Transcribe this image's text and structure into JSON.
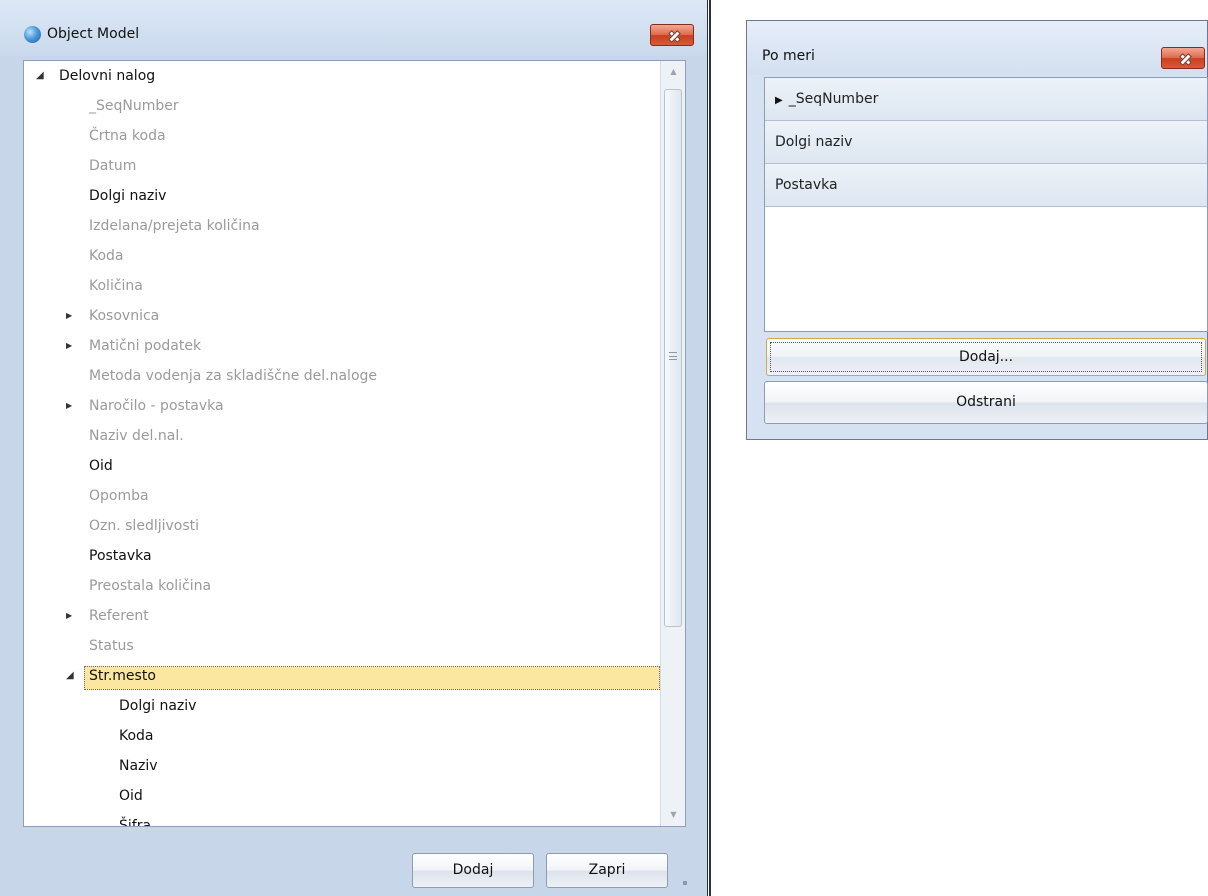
{
  "object_model_window": {
    "title": "Object Model",
    "close_icon": "close-x-icon",
    "tree": [
      {
        "label": "Delovni nalog",
        "level": 0,
        "expander": "expanded",
        "style": "dark"
      },
      {
        "label": "_SeqNumber",
        "level": 1,
        "expander": "none",
        "style": "gray"
      },
      {
        "label": "Črtna koda",
        "level": 1,
        "expander": "none",
        "style": "gray"
      },
      {
        "label": "Datum",
        "level": 1,
        "expander": "none",
        "style": "gray"
      },
      {
        "label": "Dolgi naziv",
        "level": 1,
        "expander": "none",
        "style": "dark"
      },
      {
        "label": "Izdelana/prejeta količina",
        "level": 1,
        "expander": "none",
        "style": "gray"
      },
      {
        "label": "Koda",
        "level": 1,
        "expander": "none",
        "style": "gray"
      },
      {
        "label": "Količina",
        "level": 1,
        "expander": "none",
        "style": "gray"
      },
      {
        "label": "Kosovnica",
        "level": 1,
        "expander": "collapsed",
        "style": "gray"
      },
      {
        "label": "Matični podatek",
        "level": 1,
        "expander": "collapsed",
        "style": "gray"
      },
      {
        "label": "Metoda vodenja za skladiščne del.naloge",
        "level": 1,
        "expander": "none",
        "style": "gray"
      },
      {
        "label": "Naročilo - postavka",
        "level": 1,
        "expander": "collapsed",
        "style": "gray"
      },
      {
        "label": "Naziv del.nal.",
        "level": 1,
        "expander": "none",
        "style": "gray"
      },
      {
        "label": "Oid",
        "level": 1,
        "expander": "none",
        "style": "dark"
      },
      {
        "label": "Opomba",
        "level": 1,
        "expander": "none",
        "style": "gray"
      },
      {
        "label": "Ozn. sledljivosti",
        "level": 1,
        "expander": "none",
        "style": "gray"
      },
      {
        "label": "Postavka",
        "level": 1,
        "expander": "none",
        "style": "dark"
      },
      {
        "label": "Preostala količina",
        "level": 1,
        "expander": "none",
        "style": "gray"
      },
      {
        "label": "Referent",
        "level": 1,
        "expander": "collapsed",
        "style": "gray"
      },
      {
        "label": "Status",
        "level": 1,
        "expander": "none",
        "style": "gray"
      },
      {
        "label": "Str.mesto",
        "level": 1,
        "expander": "expanded",
        "style": "dark",
        "selected": true
      },
      {
        "label": "Dolgi naziv",
        "level": 2,
        "expander": "none",
        "style": "dark"
      },
      {
        "label": "Koda",
        "level": 2,
        "expander": "none",
        "style": "dark"
      },
      {
        "label": "Naziv",
        "level": 2,
        "expander": "none",
        "style": "dark"
      },
      {
        "label": "Oid",
        "level": 2,
        "expander": "none",
        "style": "dark"
      },
      {
        "label": "Šifra",
        "level": 2,
        "expander": "none",
        "style": "dark"
      }
    ],
    "scrollbar_grip_icon": "scroll-grip-icon",
    "add_button": "Dodaj",
    "close_button": "Zapri"
  },
  "po_meri_window": {
    "title": "Po meri",
    "close_icon": "close-x-icon",
    "items": [
      {
        "label": "_SeqNumber",
        "has_arrow": true
      },
      {
        "label": "Dolgi naziv",
        "has_arrow": false
      },
      {
        "label": "Postavka",
        "has_arrow": false
      }
    ],
    "add_button": "Dodaj...",
    "remove_button": "Odstrani"
  },
  "colors": {
    "window_frame": "#c7d6e9",
    "selection_fill": "#fbe7a0",
    "close_button_red": "#d95a38",
    "disabled_text": "#9a9a9a"
  }
}
